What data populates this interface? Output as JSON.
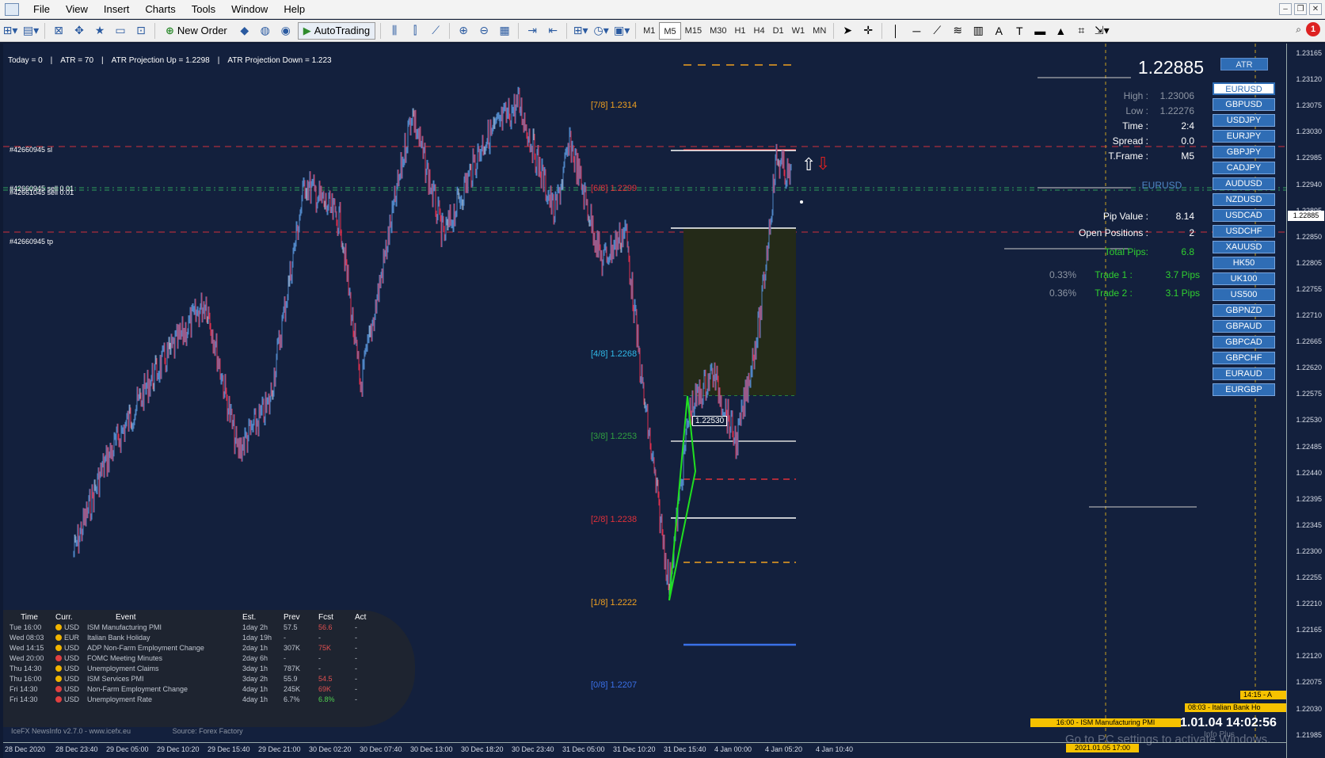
{
  "menu": {
    "items": [
      "File",
      "View",
      "Insert",
      "Charts",
      "Tools",
      "Window",
      "Help"
    ]
  },
  "toolbar": {
    "new_order_label": "New Order",
    "autotrading_label": "AutoTrading",
    "timeframes": [
      "M1",
      "M5",
      "M15",
      "M30",
      "H1",
      "H4",
      "D1",
      "W1",
      "MN"
    ],
    "active_timeframe": "M5",
    "alert_count": "1"
  },
  "chart": {
    "atr_info": {
      "today": "Today = 0",
      "atr": "ATR = 70",
      "proj_up": "ATR Projection Up = 1.2298",
      "proj_down": "ATR Projection Down = 1.223"
    },
    "trade_tags": {
      "sl": "#42660945 sl",
      "sell1": "#42660945 sell 0.01",
      "sell2": "#42661045 sell 0.01",
      "tp": "#42660945 tp"
    },
    "murrey_levels": [
      {
        "label": "[7/8]",
        "price": "1.2314",
        "color": "#f0a020"
      },
      {
        "label": "[6/8]",
        "price": "1.2299",
        "color": "#e0303a"
      },
      {
        "label": "[4/8]",
        "price": "1.2268",
        "color": "#30b8e8"
      },
      {
        "label": "[3/8]",
        "price": "1.2253",
        "color": "#30a040"
      },
      {
        "label": "[2/8]",
        "price": "1.2238",
        "color": "#e0303a"
      },
      {
        "label": "[1/8]",
        "price": "1.2222",
        "color": "#f0a020"
      },
      {
        "label": "[0/8]",
        "price": "1.2207",
        "color": "#3a70e8"
      }
    ],
    "box_price": "1.22530",
    "colors": {
      "bull": "#4f86c6",
      "bear": "#e0304e",
      "neutral": "#b0b6c0",
      "background": "#13203d"
    }
  },
  "info_panel": {
    "price": "1.22885",
    "high_label": "High :",
    "high": "1.23006",
    "low_label": "Low :",
    "low": "1.22276",
    "time_label": "Time :",
    "time": "2:4",
    "spread_label": "Spread :",
    "spread": "0.0",
    "tframe_label": "T.Frame :",
    "tframe": "M5",
    "symbol": "EURUSD",
    "pip_value_label": "Pip Value :",
    "pip_value": "8.14",
    "open_positions_label": "Open Positions :",
    "open_positions": "2",
    "total_pips_label": "Total Pips:",
    "total_pips": "6.8",
    "trades": [
      {
        "pct": "0.33%",
        "label": "Trade 1 :",
        "pips": "3.7 Pips"
      },
      {
        "pct": "0.36%",
        "label": "Trade 2 :",
        "pips": "3.1 Pips"
      }
    ]
  },
  "symbols": {
    "atr_button": "ATR",
    "selected": "EURUSD",
    "list": [
      "EURUSD",
      "GBPUSD",
      "USDJPY",
      "EURJPY",
      "GBPJPY",
      "CADJPY",
      "AUDUSD",
      "NZDUSD",
      "USDCAD",
      "USDCHF",
      "XAUUSD",
      "HK50",
      "UK100",
      "US500",
      "GBPNZD",
      "GBPAUD",
      "GBPCAD",
      "GBPCHF",
      "EURAUD",
      "EURGBP"
    ]
  },
  "price_axis": {
    "labels": [
      "1.23165",
      "1.23120",
      "1.23075",
      "1.23030",
      "1.22985",
      "1.22940",
      "1.22895",
      "1.22850",
      "1.22805",
      "1.22755",
      "1.22710",
      "1.22665",
      "1.22620",
      "1.22575",
      "1.22530",
      "1.22485",
      "1.22440",
      "1.22395",
      "1.22345",
      "1.22300",
      "1.22255",
      "1.22210",
      "1.22165",
      "1.22120",
      "1.22075",
      "1.22030",
      "1.21985"
    ],
    "current": "1.22885"
  },
  "time_axis": {
    "labels": [
      "28 Dec 2020",
      "28 Dec 23:40",
      "29 Dec 05:00",
      "29 Dec 10:20",
      "29 Dec 15:40",
      "29 Dec 21:00",
      "30 Dec 02:20",
      "30 Dec 07:40",
      "30 Dec 13:00",
      "30 Dec 18:20",
      "30 Dec 23:40",
      "31 Dec 05:00",
      "31 Dec 10:20",
      "31 Dec 15:40",
      "4 Jan 00:00",
      "4 Jan 05:20",
      "4 Jan 10:40"
    ]
  },
  "news": {
    "headers": [
      "Time",
      "Curr.",
      "Event",
      "Est.",
      "Prev",
      "Fcst",
      "Act"
    ],
    "rows": [
      {
        "day": "Tue",
        "time": "16:00",
        "impact": "#f0b400",
        "curr": "USD",
        "event": "ISM Manufacturing PMI",
        "est": "1day 2h",
        "prev": "57.5",
        "fcst": "56.6",
        "fcst_color": "#e05050",
        "act": "-"
      },
      {
        "day": "Wed",
        "time": "08:03",
        "impact": "#f0b400",
        "curr": "EUR",
        "event": "Italian Bank Holiday",
        "est": "1day 19h",
        "prev": "-",
        "fcst": "-",
        "fcst_color": "#c0c6d0",
        "act": "-"
      },
      {
        "day": "Wed",
        "time": "14:15",
        "impact": "#f0b400",
        "curr": "USD",
        "event": "ADP Non-Farm Employment Change",
        "est": "2day 1h",
        "prev": "307K",
        "fcst": "75K",
        "fcst_color": "#e05050",
        "act": "-"
      },
      {
        "day": "Wed",
        "time": "20:00",
        "impact": "#e04040",
        "curr": "USD",
        "event": "FOMC Meeting Minutes",
        "est": "2day 6h",
        "prev": "-",
        "fcst": "-",
        "fcst_color": "#c0c6d0",
        "act": "-"
      },
      {
        "day": "Thu",
        "time": "14:30",
        "impact": "#f0b400",
        "curr": "USD",
        "event": "Unemployment Claims",
        "est": "3day 1h",
        "prev": "787K",
        "fcst": "-",
        "fcst_color": "#c0c6d0",
        "act": "-"
      },
      {
        "day": "Thu",
        "time": "16:00",
        "impact": "#f0b400",
        "curr": "USD",
        "event": "ISM Services PMI",
        "est": "3day 2h",
        "prev": "55.9",
        "fcst": "54.5",
        "fcst_color": "#e05050",
        "act": "-"
      },
      {
        "day": "Fri",
        "time": "14:30",
        "impact": "#e04040",
        "curr": "USD",
        "event": "Non-Farm Employment Change",
        "est": "4day 1h",
        "prev": "245K",
        "fcst": "69K",
        "fcst_color": "#e05050",
        "act": "-"
      },
      {
        "day": "Fri",
        "time": "14:30",
        "impact": "#e04040",
        "curr": "USD",
        "event": "Unemployment Rate",
        "est": "4day 1h",
        "prev": "6.7%",
        "fcst": "6.8%",
        "fcst_color": "#50d050",
        "act": "-"
      }
    ],
    "footer_version": "IceFX NewsInfo v2.7.0  -  www.icefx.eu",
    "footer_source": "Source: Forex Factory"
  },
  "events": {
    "tag1": "14:15 - A",
    "tag2": "08:03 - Italian Bank Ho",
    "tag3": "16:00 - ISM Manufacturing PMI",
    "tag4": "2021.01.05 17:00"
  },
  "clock": "1.01.04 14:02:56",
  "watermark": "Go to PC settings to activate Windows.",
  "watermark2": "Info Plus"
}
